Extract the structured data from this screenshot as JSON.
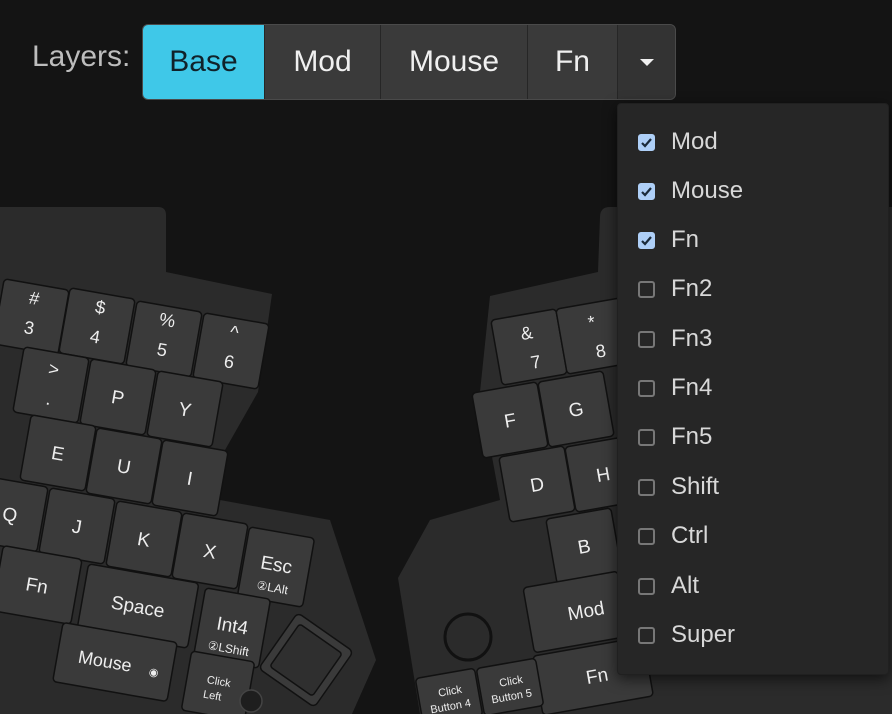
{
  "layers_label": "Layers:",
  "tabs": [
    {
      "label": "Base",
      "active": true
    },
    {
      "label": "Mod",
      "active": false
    },
    {
      "label": "Mouse",
      "active": false
    },
    {
      "label": "Fn",
      "active": false
    }
  ],
  "dropdown_icon": "caret-down-icon",
  "menu": [
    {
      "label": "Mod",
      "checked": true
    },
    {
      "label": "Mouse",
      "checked": true
    },
    {
      "label": "Fn",
      "checked": true
    },
    {
      "label": "Fn2",
      "checked": false
    },
    {
      "label": "Fn3",
      "checked": false
    },
    {
      "label": "Fn4",
      "checked": false
    },
    {
      "label": "Fn5",
      "checked": false
    },
    {
      "label": "Shift",
      "checked": false
    },
    {
      "label": "Ctrl",
      "checked": false
    },
    {
      "label": "Alt",
      "checked": false
    },
    {
      "label": "Super",
      "checked": false
    }
  ],
  "keyboard": {
    "left": {
      "num_3": {
        "top": "#",
        "bottom": "3"
      },
      "num_4": {
        "top": "$",
        "bottom": "4"
      },
      "num_5": {
        "top": "%",
        "bottom": "5"
      },
      "num_6": {
        "top": "^",
        "bottom": "6"
      },
      "gt": {
        "top": ">",
        "bottom": "."
      },
      "p": "P",
      "y": "Y",
      "e": "E",
      "u": "U",
      "i": "I",
      "q": "Q",
      "j": "J",
      "k": "K",
      "x": "X",
      "esc": {
        "main": "Esc",
        "sub": "②LAlt"
      },
      "fn": "Fn",
      "space": "Space",
      "int4": {
        "main": "Int4",
        "sub": "②LShift"
      },
      "mouse": "Mouse",
      "click_left": {
        "line1": "Click",
        "line2": "Left"
      }
    },
    "right": {
      "num_7": {
        "top": "&",
        "bottom": "7"
      },
      "num_8": {
        "top": "*",
        "bottom": "8"
      },
      "f": "F",
      "g": "G",
      "d": "D",
      "h": "H",
      "b": "B",
      "mod": "Mod",
      "fn": "Fn",
      "button4": {
        "line1": "Click",
        "line2": "Button 4"
      },
      "button5": {
        "line1": "Click",
        "line2": "Button 5"
      }
    }
  }
}
